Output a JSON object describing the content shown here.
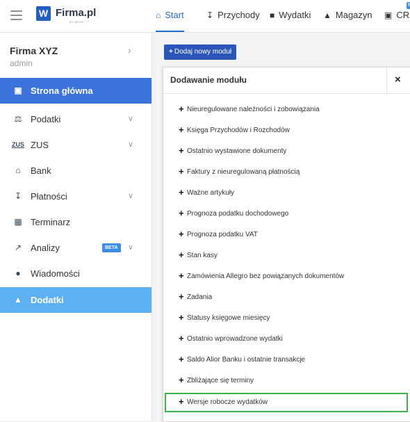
{
  "brand": {
    "logo_letter": "W",
    "name": "Firma.pl",
    "sub": "BY WOOX"
  },
  "tabs": [
    {
      "label": "Start",
      "icon": "home-icon"
    },
    {
      "label": "Przychody",
      "icon": "income-icon"
    },
    {
      "label": "Wydatki",
      "icon": "wallet-icon"
    },
    {
      "label": "Magazyn",
      "icon": "warehouse-icon"
    },
    {
      "label": "CRM",
      "icon": "crm-icon",
      "badge": "B"
    }
  ],
  "sidebar": {
    "company": "Firma XYZ",
    "user": "admin",
    "items": [
      {
        "label": "Strona główna",
        "icon": "dashboard-icon"
      },
      {
        "label": "Podatki",
        "icon": "taxes-icon"
      },
      {
        "label": "ZUS",
        "icon": "zus-icon"
      },
      {
        "label": "Bank",
        "icon": "bank-icon"
      },
      {
        "label": "Płatności",
        "icon": "payments-icon"
      },
      {
        "label": "Terminarz",
        "icon": "calendar-icon"
      },
      {
        "label": "Analizy",
        "icon": "chart-icon",
        "badge": "BETA"
      },
      {
        "label": "Wiadomości",
        "icon": "message-icon"
      },
      {
        "label": "Dodatki",
        "icon": "addons-icon"
      }
    ]
  },
  "main": {
    "add_module_button": "Dodaj nowy moduł"
  },
  "dialog": {
    "title": "Dodawanie modułu",
    "close": "×",
    "modules": [
      "Nieuregulowane należności i zobowiązania",
      "Księga Przychodów i Rozchodów",
      "Ostatnio wystawione dokumenty",
      "Faktury z nieuregulowaną płatnością",
      "Ważne artykuły",
      "Prognoza podatku dochodowego",
      "Prognoza podatku VAT",
      "Stan kasy",
      "Zamówienia Allegro bez powiązanych dokumentów",
      "Zadania",
      "Statusy księgowe miesięcy",
      "Ostatnio wprowadzone wydatki",
      "Saldo Alior Banku i ostatnie transakcje",
      "Zbliżające się terminy",
      "Wersje robocze wydatków"
    ],
    "selected_index": 14
  },
  "colors": {
    "brand_blue": "#1f5fbf",
    "active_nav": "#3b72dc",
    "active_nav_light": "#5db1f0",
    "button": "#2b55b8",
    "highlight_border": "#3bb34a"
  }
}
